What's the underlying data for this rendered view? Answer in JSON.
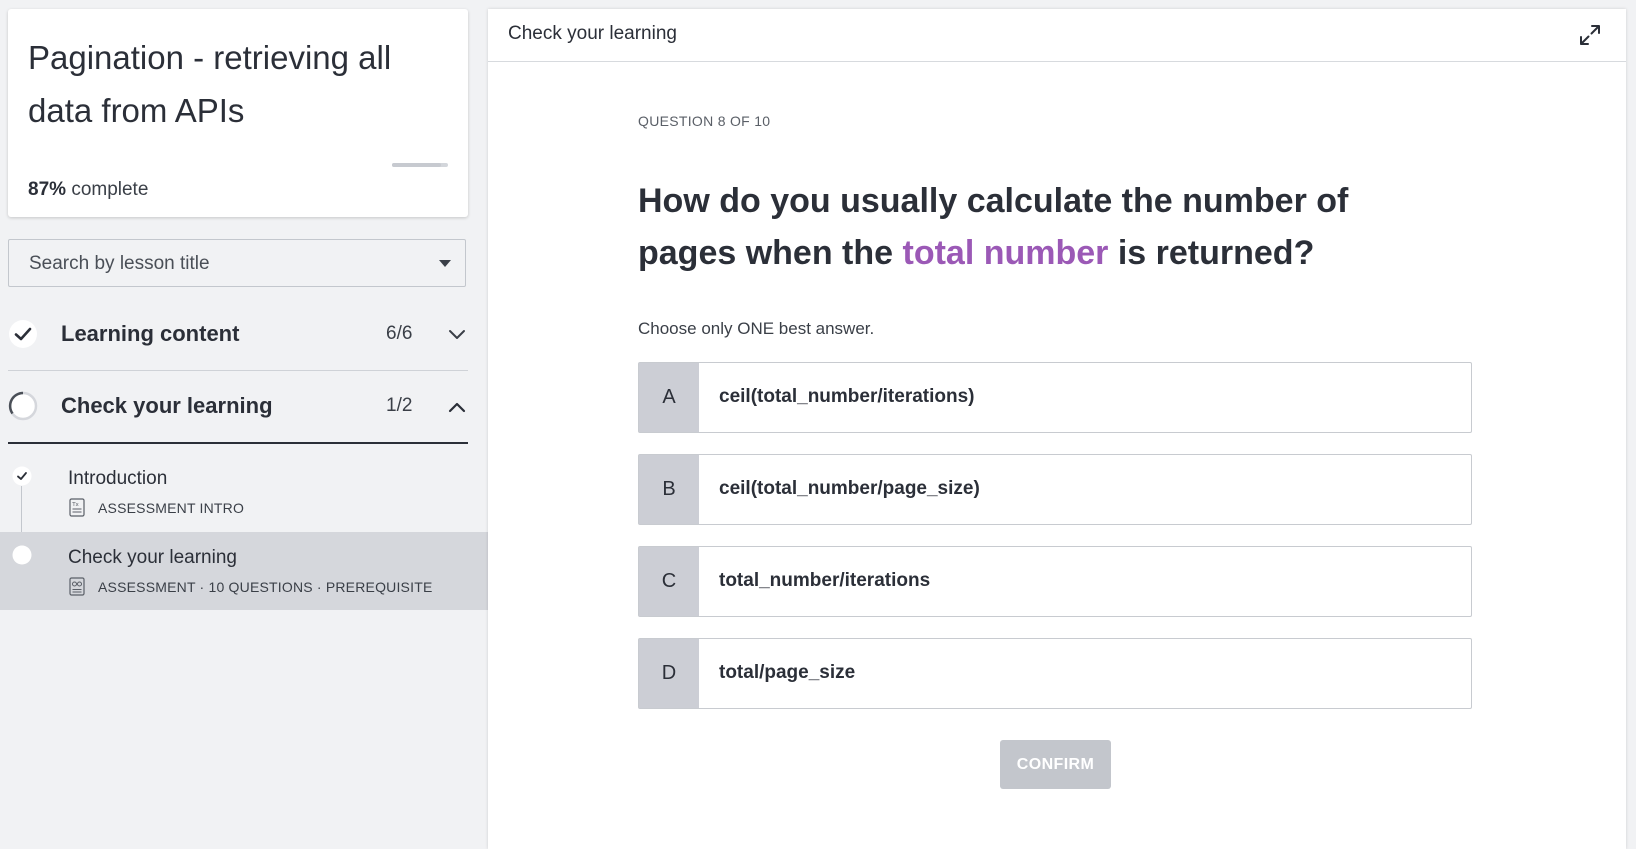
{
  "course": {
    "title": "Pagination - retrieving all data from APIs",
    "progress_percent": "87%",
    "progress_suffix": "complete",
    "progress_fraction": 0.87
  },
  "search": {
    "placeholder": "Search by lesson title"
  },
  "sections": [
    {
      "label": "Learning content",
      "count": "6/6",
      "status": "complete",
      "expanded": false
    },
    {
      "label": "Check your learning",
      "count": "1/2",
      "status": "in-progress",
      "expanded": true
    }
  ],
  "lessons": [
    {
      "name": "Introduction",
      "meta": "ASSESSMENT INTRO",
      "status": "complete",
      "active": false
    },
    {
      "name": "Check your learning",
      "meta": "ASSESSMENT · 10 QUESTIONS · PREREQUISITE",
      "status": "current",
      "active": true
    }
  ],
  "header": {
    "title": "Check your learning",
    "expand_icon": "expand-icon"
  },
  "question": {
    "counter": "QUESTION 8 OF 10",
    "text_before": "How do you usually calculate the number of pages when the ",
    "text_highlight": "total number",
    "text_after": " is returned?",
    "instructions": "Choose only ONE best answer.",
    "options": [
      {
        "letter": "A",
        "text": "ceil(total_number/iterations)"
      },
      {
        "letter": "B",
        "text": "ceil(total_number/page_size)"
      },
      {
        "letter": "C",
        "text": "total_number/iterations"
      },
      {
        "letter": "D",
        "text": "total/page_size"
      }
    ],
    "confirm_label": "CONFIRM"
  },
  "colors": {
    "highlight": "#9b59b6",
    "option_letter_bg": "#ccced5",
    "confirm_disabled": "#c3c6cc"
  }
}
